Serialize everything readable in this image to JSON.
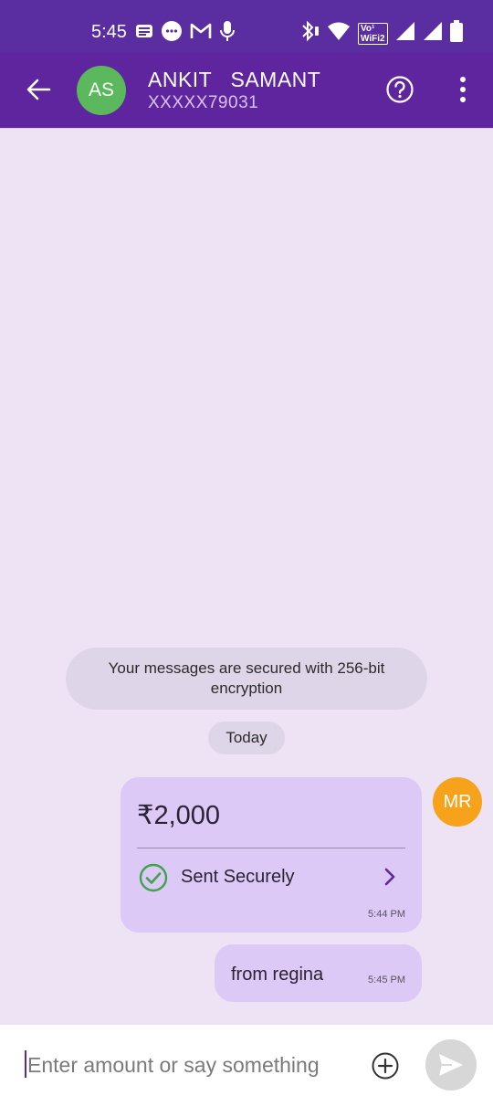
{
  "status_bar": {
    "time": "5:45",
    "left_icons": [
      "notes-icon",
      "messages-icon",
      "gmail-icon",
      "mic-icon"
    ],
    "right_icons": [
      "bluetooth-icon",
      "wifi-icon",
      "vowifi-icon",
      "signal-icon",
      "signal-icon",
      "battery-icon"
    ],
    "volte_label": "Vo¹",
    "wifi_label": "WiFi2"
  },
  "header": {
    "avatar_initials": "AS",
    "contact_name": "ANKIT   SAMANT",
    "contact_number": "XXXXX79031",
    "avatar_color": "#5cb85c",
    "bar_color": "#5f259f"
  },
  "chat": {
    "encryption_notice": "Your messages are secured with 256-bit encryption",
    "date_label": "Today",
    "payment": {
      "amount": "₹2,000",
      "status": "Sent Securely",
      "time": "5:44 PM"
    },
    "sender_initials": "MR",
    "sender_avatar_color": "#f6a21a",
    "message": {
      "text": "from regina",
      "time": "5:45 PM"
    }
  },
  "composer": {
    "placeholder": "Enter amount or say something"
  }
}
